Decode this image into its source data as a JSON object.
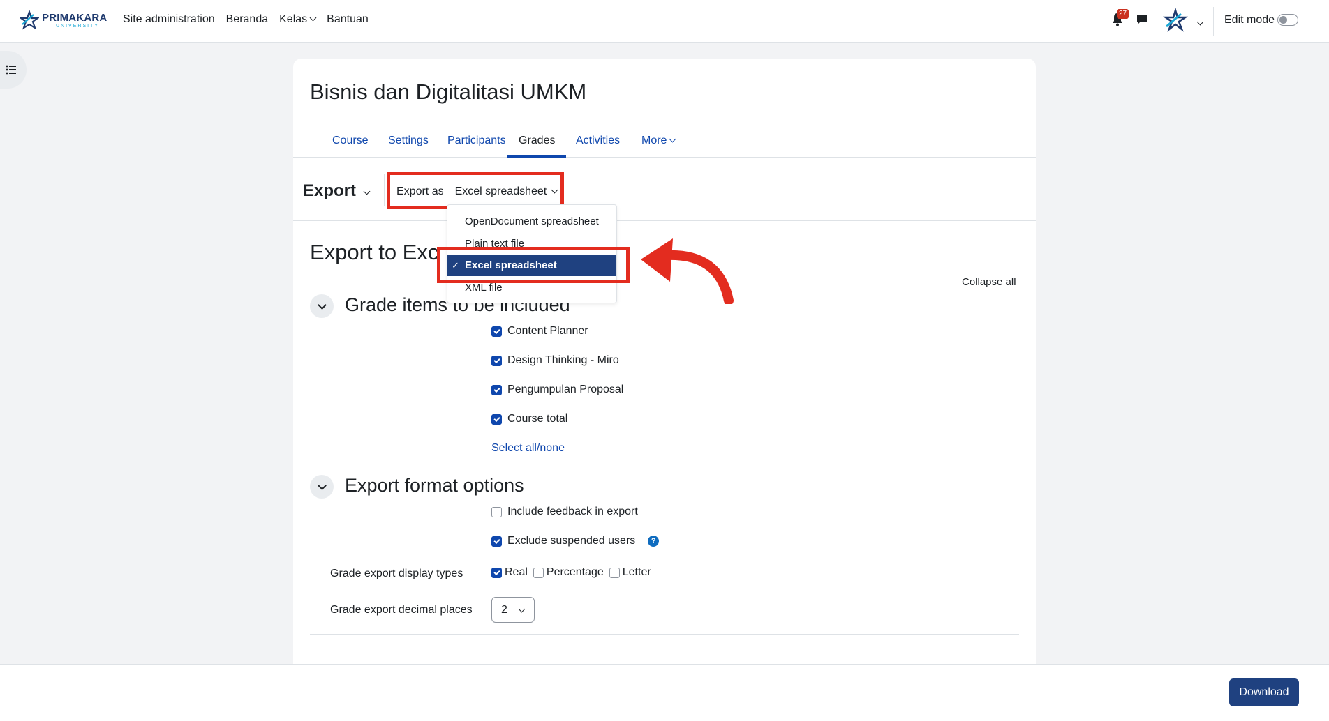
{
  "navbar": {
    "logo_text": "PRIMAKARA",
    "logo_sub": "UNIVERSITY",
    "links": [
      "Site administration",
      "Beranda",
      "Kelas",
      "Bantuan"
    ],
    "notifications_count": "27",
    "edit_mode_label": "Edit mode"
  },
  "course": {
    "title": "Bisnis dan Digitalitasi UMKM",
    "tabs": [
      "Course",
      "Settings",
      "Participants",
      "Grades",
      "Activities",
      "More"
    ],
    "active_tab": "Grades"
  },
  "export_bar": {
    "heading": "Export",
    "export_as_label": "Export as",
    "selected_format": "Excel spreadsheet"
  },
  "format_menu": {
    "options": [
      "OpenDocument spreadsheet",
      "Plain text file",
      "Excel spreadsheet",
      "XML file"
    ],
    "selected": "Excel spreadsheet"
  },
  "page": {
    "title": "Export to Excel spreadsheet",
    "title_visible": "Export to Exc",
    "collapse_all": "Collapse all"
  },
  "grade_items": {
    "heading": "Grade items to be included",
    "items": [
      {
        "label": "Content Planner",
        "checked": true
      },
      {
        "label": "Design Thinking - Miro",
        "checked": true
      },
      {
        "label": "Pengumpulan Proposal",
        "checked": true
      },
      {
        "label": "Course total",
        "checked": true
      }
    ],
    "select_all": "Select all/none"
  },
  "format_options": {
    "heading": "Export format options",
    "include_feedback": {
      "label": "Include feedback in export",
      "checked": false
    },
    "exclude_suspended": {
      "label": "Exclude suspended users",
      "checked": true
    },
    "display_types_label": "Grade export display types",
    "display_types": [
      {
        "label": "Real",
        "checked": true
      },
      {
        "label": "Percentage",
        "checked": false
      },
      {
        "label": "Letter",
        "checked": false
      }
    ],
    "decimal_places_label": "Grade export decimal places",
    "decimal_places": "2"
  },
  "footer": {
    "download_label": "Download"
  },
  "colors": {
    "annotation_red": "#e32c1f",
    "primary": "#1f4180",
    "link": "#0f47ad"
  }
}
